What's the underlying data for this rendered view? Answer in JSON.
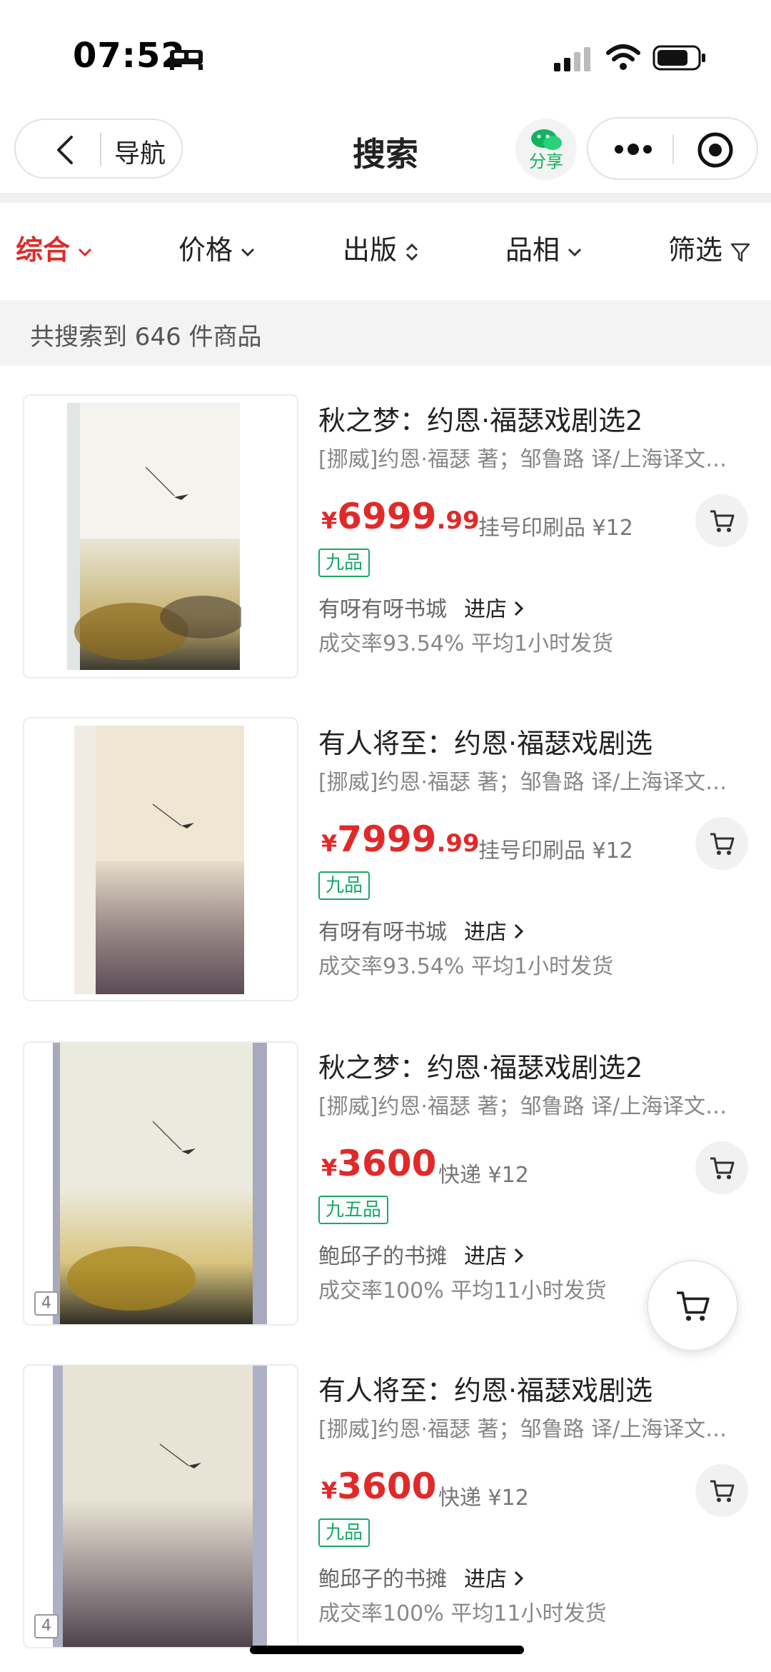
{
  "status_bar": {
    "time": "07:52"
  },
  "header": {
    "back_label": "导航",
    "title": "搜索",
    "share_label": "分享"
  },
  "filters": [
    {
      "label": "综合",
      "active": true
    },
    {
      "label": "价格",
      "active": false
    },
    {
      "label": "出版",
      "active": false
    },
    {
      "label": "品相",
      "active": false
    },
    {
      "label": "筛选",
      "active": false
    }
  ],
  "result_count": "共搜索到 646 件商品",
  "products": [
    {
      "title": "秋之梦：约恩·福瑟戏剧选2",
      "subtitle": "[挪威]约恩·福瑟 著；邹鲁路 译/上海译文出版社",
      "price_symbol": "¥",
      "price_int": "6999",
      "price_dec": ".99",
      "shipping": "挂号印刷品 ¥12",
      "condition": "九品",
      "shop": "有呀有呀书城",
      "shop_link": "进店",
      "stats": "成交率93.54%  平均1小时发货",
      "thumb_badge": ""
    },
    {
      "title": "有人将至：约恩·福瑟戏剧选",
      "subtitle": "[挪威]约恩·福瑟 著；邹鲁路 译/上海译文出版社",
      "price_symbol": "¥",
      "price_int": "7999",
      "price_dec": ".99",
      "shipping": "挂号印刷品 ¥12",
      "condition": "九品",
      "shop": "有呀有呀书城",
      "shop_link": "进店",
      "stats": "成交率93.54%  平均1小时发货",
      "thumb_badge": ""
    },
    {
      "title": "秋之梦：约恩·福瑟戏剧选2",
      "subtitle": "[挪威]约恩·福瑟 著；邹鲁路 译/上海译文出版社",
      "price_symbol": "¥",
      "price_int": "3600",
      "price_dec": "",
      "shipping": "快递 ¥12",
      "condition": "九五品",
      "shop": "鲍邱子的书摊",
      "shop_link": "进店",
      "stats": "成交率100%  平均11小时发货",
      "thumb_badge": "4"
    },
    {
      "title": "有人将至：约恩·福瑟戏剧选",
      "subtitle": "[挪威]约恩·福瑟 著；邹鲁路 译/上海译文出版社",
      "price_symbol": "¥",
      "price_int": "3600",
      "price_dec": "",
      "shipping": "快递 ¥12",
      "condition": "九品",
      "shop": "鲍邱子的书摊",
      "shop_link": "进店",
      "stats": "成交率100%  平均11小时发货",
      "thumb_badge": "4"
    }
  ],
  "colors": {
    "accent": "#e02a2a",
    "condition": "#19a86a",
    "share": "#12b25e"
  },
  "icons": [
    "bed-icon",
    "signal-icon",
    "wifi-icon",
    "battery-icon",
    "back-arrow-icon",
    "share-icon",
    "more-dots-icon",
    "target-icon",
    "chevron-down-icon",
    "sort-icon",
    "filter-icon",
    "chevron-right-icon",
    "cart-icon"
  ]
}
